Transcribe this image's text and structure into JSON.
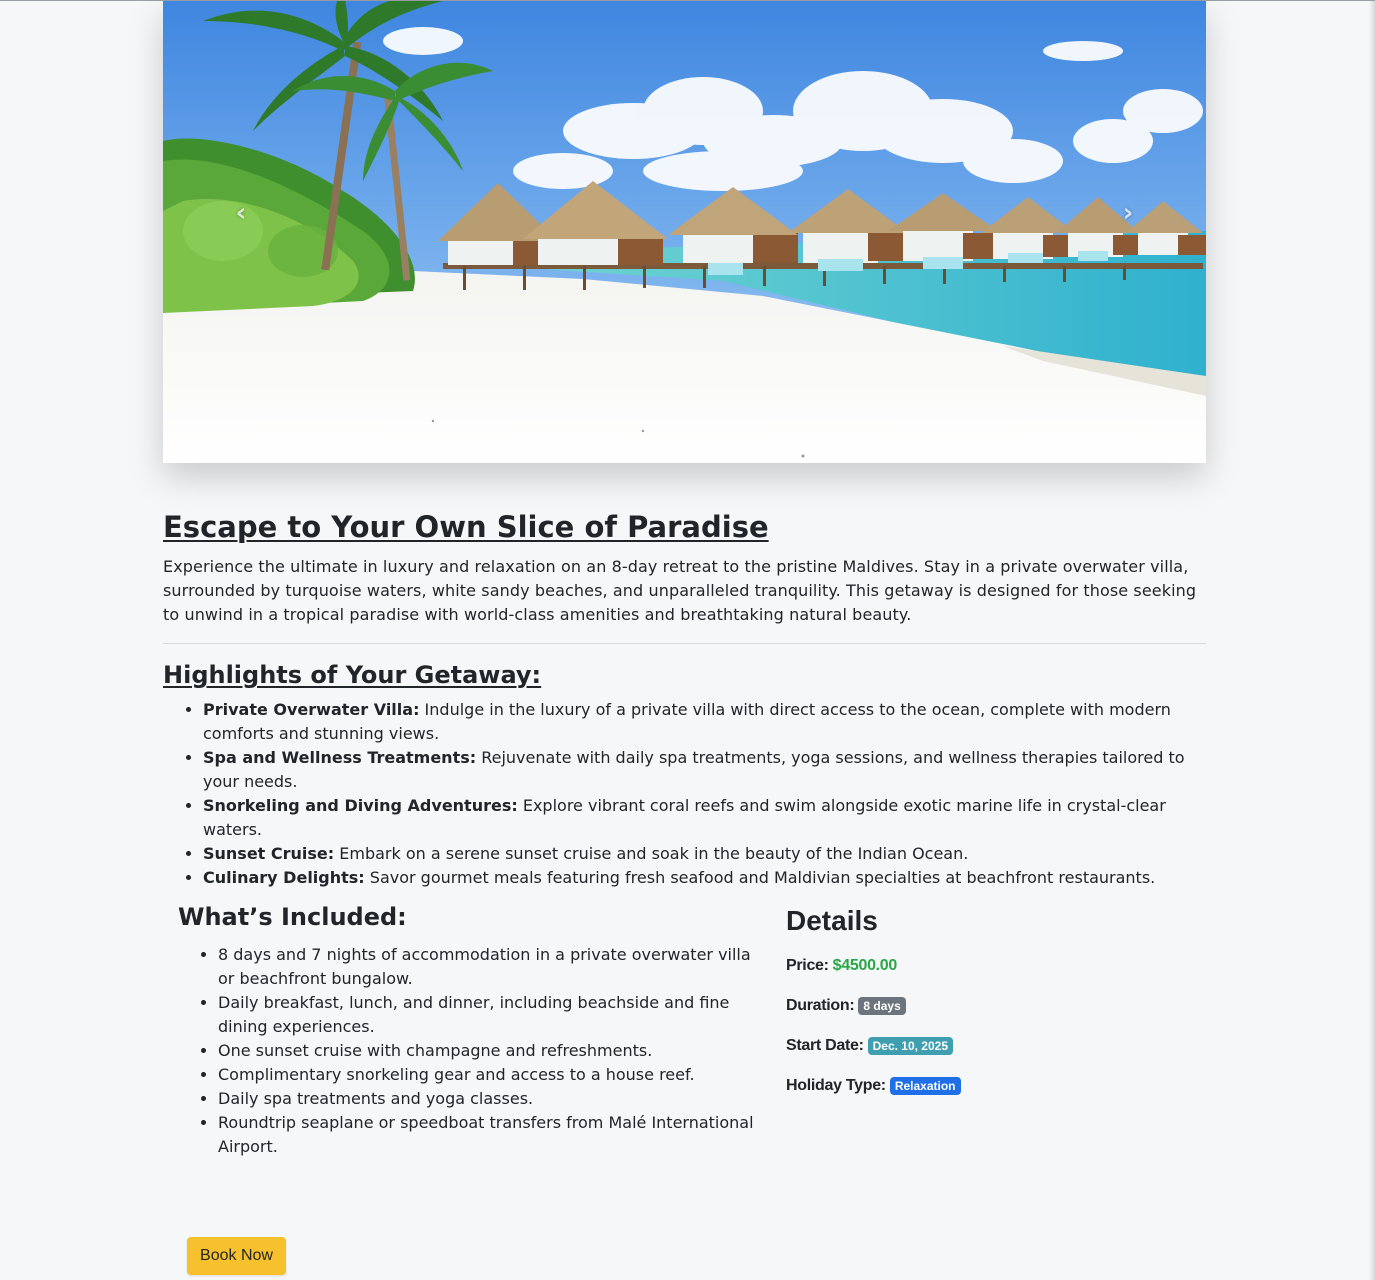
{
  "carousel": {
    "image_alt": "Overwater villas on a white sand beach with palm trees",
    "prev_glyph": "‹",
    "next_glyph": "›"
  },
  "intro": {
    "title": "Escape to Your Own Slice of Paradise",
    "description": "Experience the ultimate in luxury and relaxation on an 8-day retreat to the pristine Maldives. Stay in a private overwater villa, surrounded by turquoise waters, white sandy beaches, and unparalleled tranquility. This getaway is designed for those seeking to unwind in a tropical paradise with world-class amenities and breathtaking natural beauty."
  },
  "highlights": {
    "title": "Highlights of Your Getaway:",
    "items": [
      {
        "label": "Private Overwater Villa:",
        "text": " Indulge in the luxury of a private villa with direct access to the ocean, complete with modern comforts and stunning views."
      },
      {
        "label": "Spa and Wellness Treatments:",
        "text": " Rejuvenate with daily spa treatments, yoga sessions, and wellness therapies tailored to your needs."
      },
      {
        "label": "Snorkeling and Diving Adventures:",
        "text": " Explore vibrant coral reefs and swim alongside exotic marine life in crystal-clear waters."
      },
      {
        "label": "Sunset Cruise:",
        "text": " Embark on a serene sunset cruise and soak in the beauty of the Indian Ocean."
      },
      {
        "label": "Culinary Delights:",
        "text": " Savor gourmet meals featuring fresh seafood and Maldivian specialties at beachfront restaurants."
      }
    ]
  },
  "included": {
    "title": "What’s Included:",
    "items": [
      "8 days and 7 nights of accommodation in a private overwater villa or beachfront bungalow.",
      "Daily breakfast, lunch, and dinner, including beachside and fine dining experiences.",
      "One sunset cruise with champagne and refreshments.",
      "Complimentary snorkeling gear and access to a house reef.",
      "Daily spa treatments and yoga classes.",
      "Roundtrip seaplane or speedboat transfers from Malé International Airport."
    ]
  },
  "details": {
    "title": "Details",
    "price_label": "Price:",
    "price_value": "$4500.00",
    "duration_label": "Duration:",
    "duration_value": "8 days",
    "start_label": "Start Date:",
    "start_value": "Dec. 10, 2025",
    "type_label": "Holiday Type:",
    "type_value": "Relaxation"
  },
  "actions": {
    "book_label": "Book Now"
  },
  "colors": {
    "background": "#f6f7f9",
    "price_green": "#28a745",
    "badge_gray": "#6c757d",
    "badge_teal": "#3f9fb0",
    "badge_blue": "#1e6fe8",
    "button_yellow": "#f7c12e"
  }
}
